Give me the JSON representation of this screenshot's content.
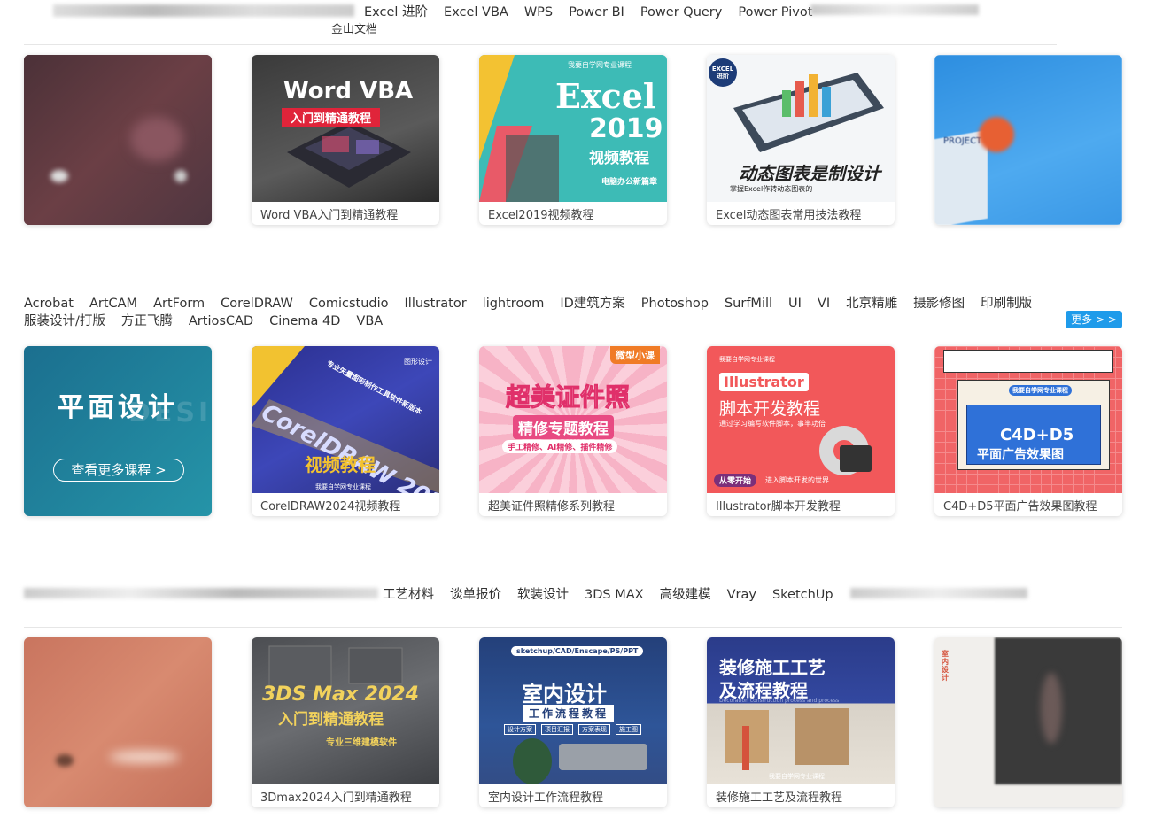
{
  "top_nav": {
    "tabs": [
      "Excel 进阶",
      "Excel VBA",
      "WPS",
      "Power BI",
      "Power Query",
      "Power Pivot"
    ],
    "second_line": "金山文档"
  },
  "section_office": {
    "courses": [
      {
        "title": ""
      },
      {
        "title": "Word VBA入门到精通教程",
        "thumb_title": "Word VBA",
        "thumb_subtitle": "入门到精通教程"
      },
      {
        "title": "Excel2019视频教程",
        "thumb_top": "我要自学网专业课程",
        "thumb_title": "Excel",
        "thumb_year": "2019",
        "thumb_subtitle": "视频教程",
        "thumb_footer": "电脑办公新篇章"
      },
      {
        "title": "Excel动态图表常用技法教程",
        "thumb_badge": "EXCEL进阶",
        "thumb_title": "动态图表是制设计",
        "thumb_sub": "掌握Excel作转动态图表的"
      },
      {
        "title": "",
        "thumb_label": "PROJECT"
      }
    ]
  },
  "section_design": {
    "tags_line1": [
      "Acrobat",
      "ArtCAM",
      "ArtForm",
      "CorelDRAW",
      "Comicstudio",
      "Illustrator",
      "lightroom",
      "ID建筑方案",
      "Photoshop",
      "SurfMill",
      "UI",
      "VI",
      "北京精雕",
      "摄影修图",
      "印刷制版"
    ],
    "tags_line2": [
      "服装设计/打版",
      "方正飞腾",
      "ArtiosCAD",
      "Cinema 4D",
      "VBA"
    ],
    "more_label": "更多 > >",
    "promo": {
      "title": "平面设计",
      "bg_text": "DESIGN",
      "button": "查看更多课程 >"
    },
    "courses": [
      {
        "title": "CorelDRAW2024视频教程",
        "thumb_tag": "图形设计",
        "thumb_title": "CorelDRAW 2024",
        "thumb_sub": "视频教程",
        "thumb_side": "专业矢量图形制作工具软件新版本",
        "thumb_footer": "我要自学网专业课程"
      },
      {
        "title": "超美证件照精修系列教程",
        "thumb_badge": "微型小课",
        "thumb_title": "超美证件照",
        "thumb_sub": "精修专题教程",
        "thumb_note": "手工精修、AI精修、插件精修"
      },
      {
        "title": "Illustrator脚本开发教程",
        "thumb_top": "我要自学网专业课程",
        "thumb_brand": "Illustrator",
        "thumb_title": "脚本开发教程",
        "thumb_sub": "通过学习编写软件脚本，事半功倍",
        "thumb_tag": "从零开始",
        "thumb_tag2": "进入脚本开发的世界"
      },
      {
        "title": "C4D+D5平面广告效果图教程",
        "thumb_top": "我要自学网专业课程",
        "thumb_title": "C4D+D5",
        "thumb_sub": "平面广告效果图"
      }
    ]
  },
  "section_interior": {
    "tags": [
      "工艺材料",
      "谈单报价",
      "软装设计",
      "3DS MAX",
      "高级建模",
      "Vray",
      "SketchUp"
    ],
    "courses": [
      {
        "title": ""
      },
      {
        "title": "3Dmax2024入门到精通教程",
        "thumb_title": "3DS Max 2024",
        "thumb_sub": "入门到精通教程",
        "thumb_note": "专业三维建模软件"
      },
      {
        "title": "室内设计工作流程教程",
        "thumb_top": "sketchup/CAD/Enscape/PS/PPT",
        "thumb_title": "室内设计",
        "thumb_sub": "工作流程教程",
        "thumb_tags": [
          "设计方案",
          "项目汇报",
          "方案表现",
          "施工图"
        ]
      },
      {
        "title": "装修施工工艺及流程教程",
        "thumb_title": "装修施工工艺",
        "thumb_sub": "及流程教程",
        "thumb_note": "Decoration construction process and process",
        "thumb_footer": "我要自学网专业课程"
      },
      {
        "title": "",
        "thumb_label": "室内设计"
      }
    ]
  },
  "colors": {
    "accent_blue": "#1f9bea",
    "promo_teal": "#1e7f9a"
  }
}
